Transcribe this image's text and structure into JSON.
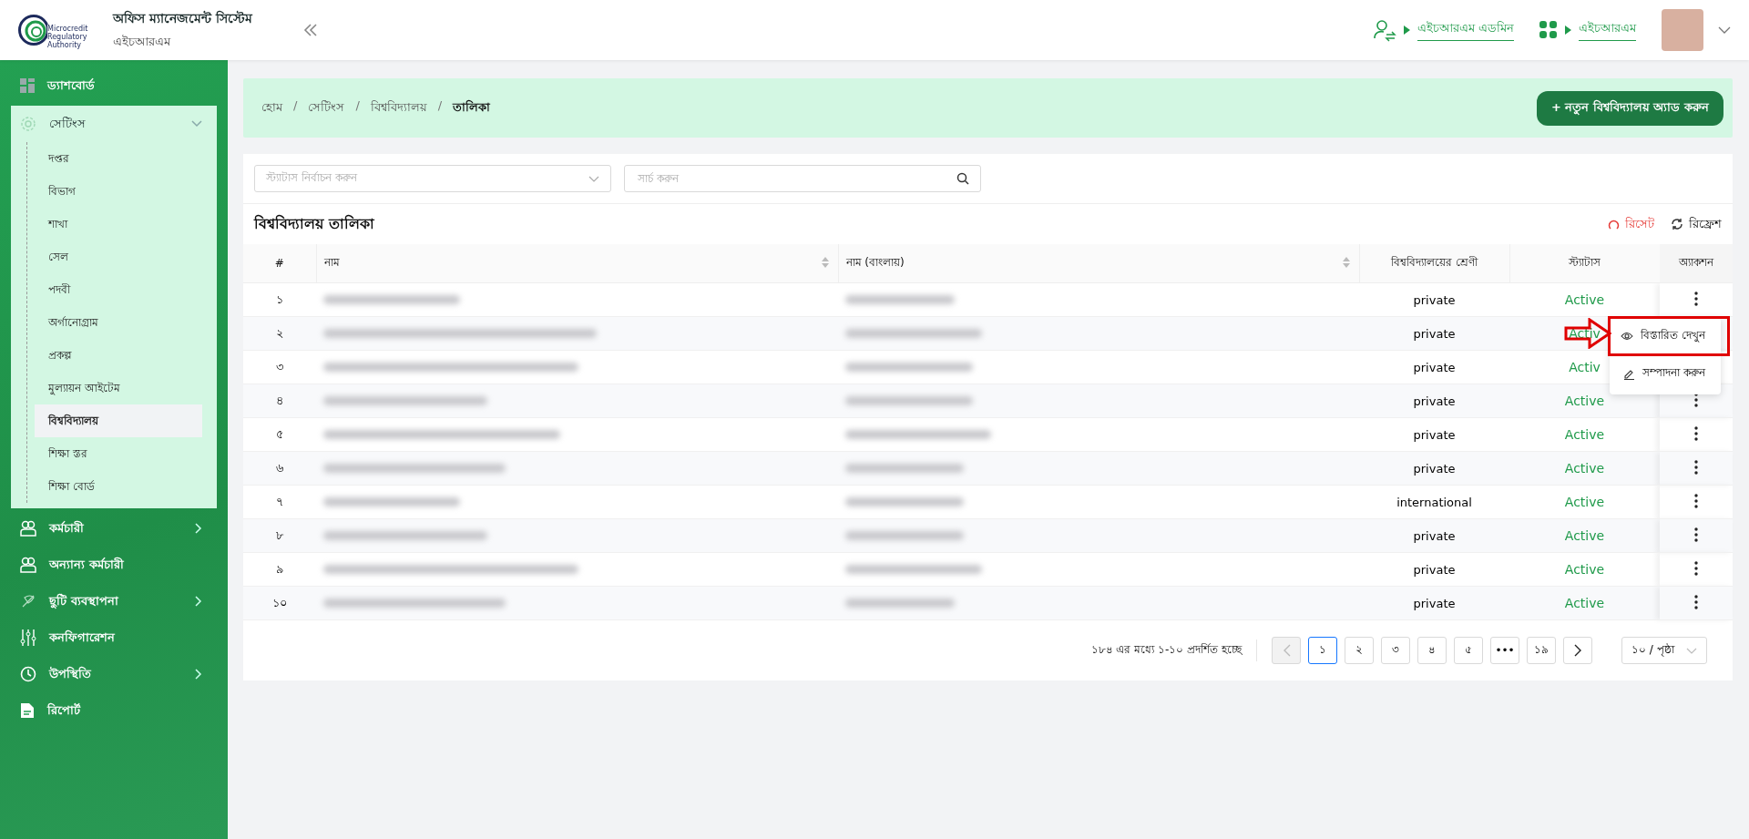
{
  "header": {
    "logo_text": [
      "Microcredit",
      "Regulatory",
      "Authority"
    ],
    "title": "অফিস ম্যানেজমেন্ট সিস্টেম",
    "subtitle": "এইচআরএম",
    "role_link": "এইচআরএম এডমিন",
    "module_link": "এইচআরএম"
  },
  "sidebar": {
    "items": [
      {
        "label": "ড্যাশবোর্ড",
        "kind": "link"
      },
      {
        "label": "সেটিংস",
        "kind": "group",
        "expanded": true,
        "children": [
          {
            "label": "দপ্তর",
            "selected": false
          },
          {
            "label": "বিভাগ",
            "selected": false
          },
          {
            "label": "শাখা",
            "selected": false
          },
          {
            "label": "সেল",
            "selected": false
          },
          {
            "label": "পদবী",
            "selected": false
          },
          {
            "label": "অর্গানোগ্রাম",
            "selected": false
          },
          {
            "label": "প্রকল্প",
            "selected": false
          },
          {
            "label": "মুল্যায়ন আইটেম",
            "selected": false
          },
          {
            "label": "বিশ্ববিদ্যালয়",
            "selected": true
          },
          {
            "label": "শিক্ষা স্তর",
            "selected": false
          },
          {
            "label": "শিক্ষা বোর্ড",
            "selected": false
          }
        ]
      },
      {
        "label": "কর্মচারী",
        "kind": "group",
        "expanded": false
      },
      {
        "label": "অন্যান্য কর্মচারী",
        "kind": "link"
      },
      {
        "label": "ছুটি ব্যবস্থাপনা",
        "kind": "group",
        "expanded": false
      },
      {
        "label": "কনফিগারেশন",
        "kind": "link"
      },
      {
        "label": "উপস্থিতি",
        "kind": "group",
        "expanded": false
      },
      {
        "label": "রিপোর্ট",
        "kind": "link"
      }
    ]
  },
  "breadcrumb": [
    "হোম",
    "সেটিংস",
    "বিশ্ববিদ্যালয়",
    "তালিকা"
  ],
  "breadcrumb_separator": "/",
  "add_button": "+ নতুন বিশ্ববিদ্যালয় অ্যাড করুন",
  "filters": {
    "status_placeholder": "স্ট্যাটাস নির্বাচন করুন",
    "search_placeholder": "সার্চ করুন"
  },
  "table_title": "বিশ্ববিদ্যালয় তালিকা",
  "reset_button": "রিসেট",
  "refresh_button": "রিফ্রেশ",
  "table": {
    "columns": [
      "#",
      "নাম",
      "নাম (বাংলায়)",
      "বিশ্ববিদ্যালয়ের শ্রেণী",
      "স্ট্যাটাস",
      "অ্যাকশন"
    ],
    "rows": [
      {
        "no": "১",
        "category": "private",
        "status": "Active"
      },
      {
        "no": "২",
        "category": "private",
        "status": "Activ"
      },
      {
        "no": "৩",
        "category": "private",
        "status": "Activ"
      },
      {
        "no": "৪",
        "category": "private",
        "status": "Active"
      },
      {
        "no": "৫",
        "category": "private",
        "status": "Active"
      },
      {
        "no": "৬",
        "category": "private",
        "status": "Active"
      },
      {
        "no": "৭",
        "category": "international",
        "status": "Active"
      },
      {
        "no": "৮",
        "category": "private",
        "status": "Active"
      },
      {
        "no": "৯",
        "category": "private",
        "status": "Active"
      },
      {
        "no": "১০",
        "category": "private",
        "status": "Active"
      }
    ]
  },
  "action_menu": [
    {
      "label": "বিস্তারিত দেখুন",
      "highlighted": true
    },
    {
      "label": "সম্পাদনা করুন",
      "highlighted": false
    }
  ],
  "pagination": {
    "summary": "১৮৪ এর মধ্যে ১-১০ প্রদর্শিত হচ্ছে",
    "prev_disabled": true,
    "next_disabled": false,
    "pages": [
      {
        "label": "১",
        "selected": true
      },
      {
        "label": "২",
        "selected": false
      },
      {
        "label": "৩",
        "selected": false
      },
      {
        "label": "৪",
        "selected": false
      },
      {
        "label": "৫",
        "selected": false
      },
      {
        "label": "•••",
        "selected": false
      },
      {
        "label": "১৯",
        "selected": false
      }
    ],
    "page_size": "১০ / পৃষ্ঠা"
  }
}
